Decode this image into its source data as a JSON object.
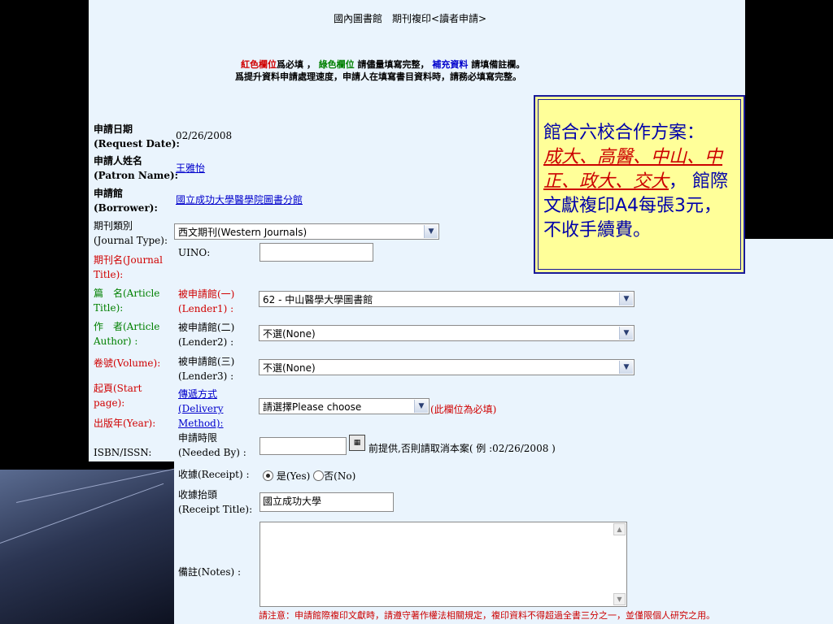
{
  "header": {
    "title": "國內圖書館　期刊複印<讀者申請>",
    "note1_red": "紅色欄位",
    "note1_a": "爲必填 ，",
    "note1_green": "綠色欄位",
    "note1_b": "請儘量填寫完整，",
    "note1_blue": "補充資料",
    "note1_c": "請填備註欄。",
    "note2": "爲提升資料申請處理速度，申請人在填寫書目資料時，請務必填寫完整。"
  },
  "left_labels": {
    "request_date_zh": "申請日期",
    "request_date_en": "(Request Date):",
    "patron_zh": "申請人姓名",
    "patron_en": "(Patron Name):",
    "borrower_zh": "申請館",
    "borrower_en": "(Borrower):",
    "journal_type_zh": "期刊類別",
    "journal_type_en": "(Journal Type):",
    "journal_title_1": "期刊名(Journal",
    "journal_title_2": "Title):",
    "article_title_1": "篇　名(Article",
    "article_title_2": "Title):",
    "author_1": "作　者(Article",
    "author_2": "Author) :",
    "volume": "卷號(Volume):",
    "start_page_1": "起頁(Start",
    "start_page_2": "page):",
    "year": "出版年(Year):",
    "isbn": "ISBN/ISSN:"
  },
  "values": {
    "request_date": "02/26/2008",
    "patron_name": "王雅怡",
    "borrower": "國立成功大學醫學院圖書分館",
    "journal_type": "西文期刊(Western Journals)"
  },
  "right_labels": {
    "uino": "UINO:",
    "lender1_zh": "被申請館(一)",
    "lender1_en": "(Lender1) :",
    "lender2_zh": "被申請館(二)",
    "lender2_en": "(Lender2) :",
    "lender3_zh": "被申請館(三)",
    "lender3_en": "(Lender3) :",
    "delivery_1": "傳遞方式",
    "delivery_2": "(Delivery",
    "delivery_3": "Method):",
    "needed_zh": "申請時限",
    "needed_en": "(Needed By) :",
    "receipt": "收據(Receipt) :",
    "receipt_title_zh": "收據抬頭",
    "receipt_title_en": "(Receipt Title):",
    "notes": "備註(Notes) :"
  },
  "fields": {
    "lender1": "62 - 中山醫學大學圖書館",
    "lender2": "不選(None)",
    "lender3": "不選(None)",
    "delivery": "請選擇Please choose",
    "delivery_required": "(此欄位為必填)",
    "needed_hint": "前提供,否則請取消本案( 例 :02/26/2008 )",
    "receipt_yes": "是(Yes)",
    "receipt_no": "否(No)",
    "receipt_title": "國立成功大學"
  },
  "footer_note": "請注意：申請館際複印文獻時，請遵守著作權法相關規定，複印資料不得超過全書三分之一，並僅限個人研究之用。",
  "callout": {
    "line1": "館合六校合作方案：",
    "schools": "成大、高醫、中山、中正、政大、交大",
    "comma": "，",
    "line3": "館際文獻複印A4每張3元，不收手續費。"
  }
}
